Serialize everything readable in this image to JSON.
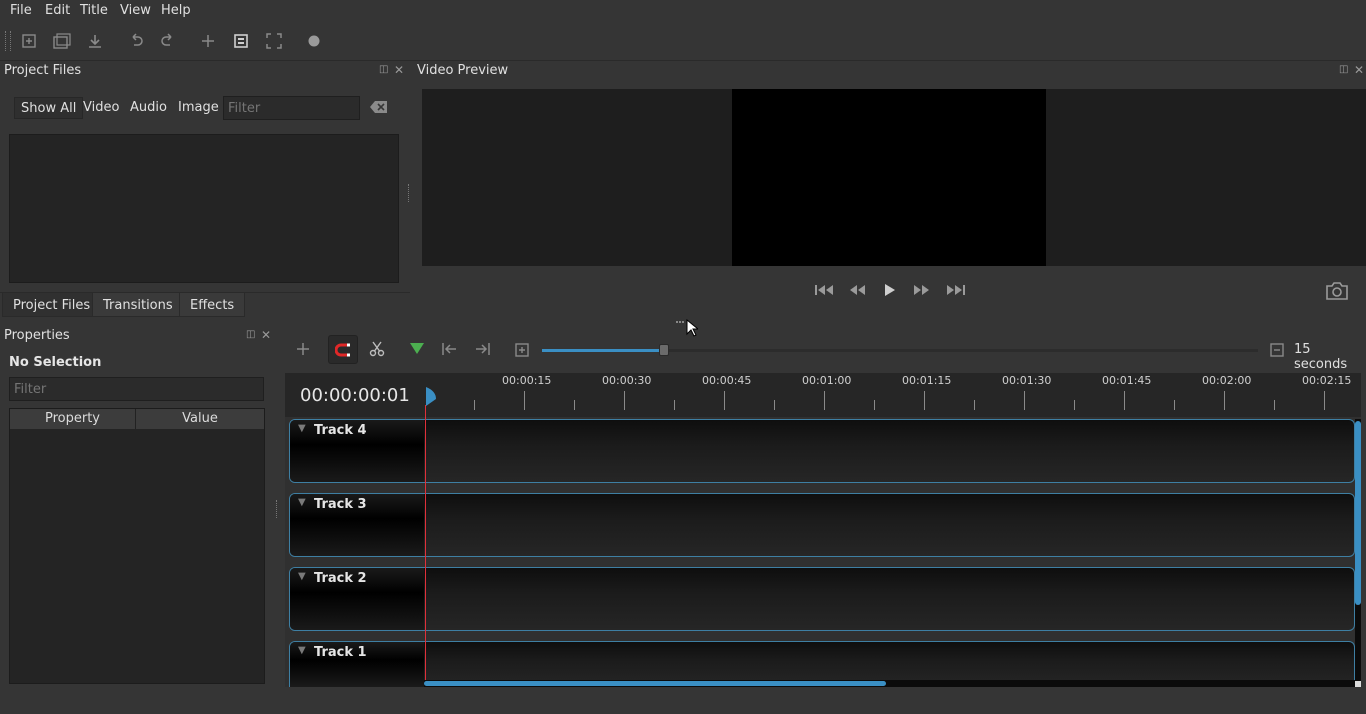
{
  "menu": {
    "file": "File",
    "edit": "Edit",
    "title": "Title",
    "view": "View",
    "help": "Help"
  },
  "project_files": {
    "title": "Project Files",
    "filters": [
      "Show All",
      "Video",
      "Audio",
      "Image"
    ],
    "filter_placeholder": "Filter"
  },
  "tabs": [
    "Project Files",
    "Transitions",
    "Effects"
  ],
  "properties": {
    "title": "Properties",
    "selection": "No Selection",
    "filter_placeholder": "Filter",
    "col_property": "Property",
    "col_value": "Value"
  },
  "preview": {
    "title": "Video Preview"
  },
  "timeline": {
    "timecode": "00:00:00:01",
    "zoom_label": "15 seconds",
    "zoom_level": 0.17,
    "ticks": [
      "00:00:15",
      "00:00:30",
      "00:00:45",
      "00:01:00",
      "00:01:15",
      "00:01:30",
      "00:01:45",
      "00:02:00",
      "00:02:15"
    ],
    "tracks": [
      "Track 4",
      "Track 3",
      "Track 2",
      "Track 1"
    ]
  },
  "colors": {
    "accent": "#3a8fc4",
    "playhead": "#e0303a",
    "snap_active": "#e02828",
    "marker": "#4caf50"
  }
}
